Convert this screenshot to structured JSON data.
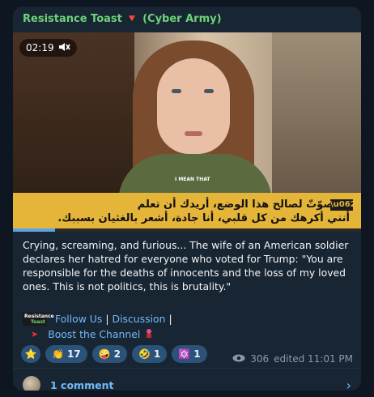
{
  "post": {
    "channel_name": "Resistance Toast 🔻 (Cyber Army)",
    "video": {
      "duration": "02:19",
      "muted": true,
      "small_caption": "I MEAN THAT",
      "subtitle_line1": "إذا صوّتّ لصالح هذا الوضع، أريدك أن تعلم",
      "subtitle_line2": "أنني أكرهك من كل قلبي، أنا جادة، أشعر بالغثيان بسببك.",
      "progress": 0.12
    },
    "body_text": "Crying, screaming, and furious... The wife of an American soldier declares her hatred for everyone who voted for Trump: \"You are responsible for the deaths of innocents and the loss of my loved ones. This is not politics, this is brutality.\"",
    "links": {
      "follow_us": "Follow Us",
      "sep1": "|",
      "discussion": "Discussion",
      "sep2": "|",
      "boost": "Boost the Channel",
      "toast_logo_line1": "Resistance",
      "toast_logo_line2": "Toast"
    },
    "reactions": [
      {
        "emoji": "⭐",
        "count": ""
      },
      {
        "emoji": "👏",
        "count": "17"
      },
      {
        "emoji": "🤪",
        "count": "2"
      },
      {
        "emoji": "🤣",
        "count": "1"
      },
      {
        "emoji": "🔯",
        "count": "1"
      }
    ],
    "views": "306",
    "edited_time": "edited 11:01 PM",
    "comments_label": "1 comment"
  },
  "colors": {
    "background": "#0e1621",
    "bubble": "#182533",
    "channel_name": "#6dd27a",
    "link": "#71baf9",
    "reaction_bg": "#2b5278",
    "subtitle_bg": "#e5b53a"
  },
  "icons": {
    "mute": "speaker-mute-icon",
    "views": "eye-icon",
    "chevron": "chevron-right-icon",
    "arrow": "red-arrow-icon",
    "fireworks": "fireworks-icon"
  }
}
